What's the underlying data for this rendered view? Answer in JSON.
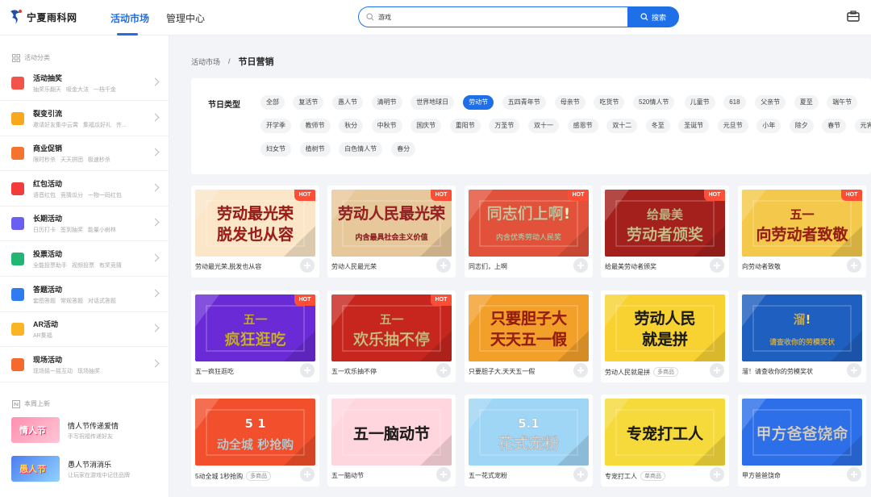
{
  "header": {
    "logo_text": "宁夏雨科网",
    "nav": [
      "活动市场",
      "管理中心"
    ],
    "search_value": "游戏",
    "search_button": "搜索"
  },
  "sidebar": {
    "category_title": "活动分类",
    "items": [
      {
        "label": "活动抽奖",
        "desc": "抽奖乐翻天 吸金大法 一档千金",
        "icon": "gift-icon",
        "color": "#f2544b"
      },
      {
        "label": "裂变引流",
        "desc": "邀请好友集中云霄 集福瓜好礼 齐...",
        "icon": "user-icon",
        "color": "#f7a91b"
      },
      {
        "label": "商业促销",
        "desc": "限时秒杀 天天拼团 极速秒杀",
        "icon": "tag-icon",
        "color": "#f5742d"
      },
      {
        "label": "红包活动",
        "desc": "语音红包 竞猜瓜分 一物一码红包",
        "icon": "envelope-icon",
        "color": "#f23b3b"
      },
      {
        "label": "长期活动",
        "desc": "日历打卡 签到抽奖 能量小树林",
        "icon": "calendar-icon",
        "color": "#6a5ff2"
      },
      {
        "label": "投票活动",
        "desc": "全能投票助手 视频投票 有奖竞猜",
        "icon": "vote-icon",
        "color": "#22b573"
      },
      {
        "label": "答题活动",
        "desc": "套图答题 常规答题 对话式答题",
        "icon": "question-icon",
        "color": "#2f7cf0"
      },
      {
        "label": "AR活动",
        "desc": "AR集福",
        "icon": "ar-icon",
        "color": "#f9b523"
      },
      {
        "label": "现场活动",
        "desc": "现场摇一摇互动 现场抽奖",
        "icon": "stage-icon",
        "color": "#f46a2c"
      }
    ],
    "new_title": "本周上新",
    "new_items": [
      {
        "label": "情人节传递爱情",
        "desc": "手写祝福传递好友",
        "thumb_text": "情人节"
      },
      {
        "label": "愚人节消消乐",
        "desc": "让玩家在游戏中记住品牌",
        "thumb_text": "愚人节"
      }
    ]
  },
  "breadcrumb": {
    "parent": "活动市场",
    "separator": "/",
    "current": "节日营销"
  },
  "filter": {
    "title": "节日类型",
    "rows": [
      [
        "全部",
        "复活节",
        "愚人节",
        "清明节",
        "世界地球日",
        "劳动节",
        "五四青年节",
        "母亲节",
        "吃货节",
        "520情人节",
        "儿童节",
        "618",
        "父亲节",
        "夏至",
        "端午节"
      ],
      [
        "开学季",
        "教师节",
        "秋分",
        "中秋节",
        "国庆节",
        "重阳节",
        "万圣节",
        "双十一",
        "感恩节",
        "双十二",
        "冬至",
        "圣诞节",
        "元旦节",
        "小年",
        "除夕",
        "春节",
        "元宵"
      ],
      [
        "妇女节",
        "植树节",
        "白色情人节",
        "春分"
      ]
    ],
    "active": "劳动节"
  },
  "cards": [
    {
      "label": "劳动最光荣,脱发也从容",
      "hot": "HOT",
      "badge": "",
      "lines": [
        "劳动最光荣",
        "脱发也从容"
      ],
      "bg": "#fbe6c8",
      "fg": "#c7231b"
    },
    {
      "label": "劳动人民最光荣",
      "hot": "HOT",
      "badge": "",
      "lines": [
        "劳动人民最光荣",
        "内含最具社会主义价值"
      ],
      "bg": "#e7c89b",
      "fg": "#c0282a"
    },
    {
      "label": "同志们，上啊",
      "hot": "HOT",
      "badge": "",
      "lines": [
        "同志们上啊!",
        "内含优秀劳动人民奖"
      ],
      "bg": "#e2523a",
      "fg": "#fff3c4"
    },
    {
      "label": "给最美劳动者颁奖",
      "hot": "HOT",
      "badge": "",
      "lines": [
        "给最美",
        "劳动者颁奖"
      ],
      "bg": "#a3201c",
      "fg": "#fde8a8"
    },
    {
      "label": "向劳动者致敬",
      "hot": "HOT",
      "badge": "",
      "lines": [
        "五一",
        "向劳动者致敬"
      ],
      "bg": "#f4c84a",
      "fg": "#c3261d"
    },
    {
      "label": "五一疯狂逛吃",
      "hot": "HOT",
      "badge": "",
      "lines": [
        "五一",
        "疯狂逛吃"
      ],
      "bg": "#6a2bd6",
      "fg": "#ffd93b"
    },
    {
      "label": "五一欢乐抽不停",
      "hot": "HOT",
      "badge": "",
      "lines": [
        "五一",
        "欢乐抽不停"
      ],
      "bg": "#c7261e",
      "fg": "#ffe39a"
    },
    {
      "label": "只要胆子大,天天五一假",
      "hot": "",
      "badge": "",
      "lines": [
        "只要胆子大",
        "天天五一假"
      ],
      "bg": "#f3a02b",
      "fg": "#c0211b"
    },
    {
      "label": "劳动人民就是拼",
      "hot": "",
      "badge": "多商品",
      "lines": [
        "劳动人民",
        "就是拼"
      ],
      "bg": "#f8d231",
      "fg": "#222"
    },
    {
      "label": "溜！请查收你的劳模奖状",
      "hot": "",
      "badge": "",
      "lines": [
        "溜!",
        "请查收你的劳模奖状"
      ],
      "bg": "#1e5fbf",
      "fg": "#ffe27a"
    },
    {
      "label": "5动全城 1秒抢购",
      "hot": "",
      "badge": "多商品",
      "lines": [
        "5 1",
        "动全城 秒抢购"
      ],
      "bg": "#f24f2c",
      "fg": "#fff"
    },
    {
      "label": "五一脑动节",
      "hot": "",
      "badge": "",
      "lines": [
        "五一脑动节"
      ],
      "bg": "#ffd6de",
      "fg": "#222"
    },
    {
      "label": "五一花式宠粉",
      "hot": "",
      "badge": "",
      "lines": [
        "5.1",
        "花式宠粉"
      ],
      "bg": "#9fd5f5",
      "fg": "#fff"
    },
    {
      "label": "专宠打工人",
      "hot": "",
      "badge": "单商品",
      "lines": [
        "专宠打工人"
      ],
      "bg": "#f6d93a",
      "fg": "#222"
    },
    {
      "label": "甲方爸爸饶命",
      "hot": "",
      "badge": "",
      "lines": [
        "甲方爸爸饶命"
      ],
      "bg": "#2d6fe8",
      "fg": "#fff"
    }
  ]
}
